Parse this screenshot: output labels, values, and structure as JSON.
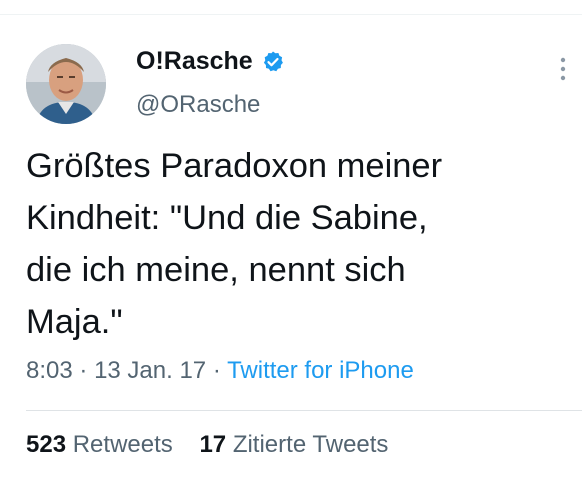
{
  "user": {
    "display_name": "O!Rasche",
    "handle": "@ORasche",
    "verified_icon": "verified-badge-icon",
    "verified_color": "#1d9bf0"
  },
  "tweet": {
    "text": "Größtes Paradoxon meiner\nKindheit: \"Und die Sabine,\ndie ich meine, nennt sich\nMaja.\"",
    "time": "8:03",
    "separator": "·",
    "date": "13 Jan. 17",
    "source": "Twitter for iPhone"
  },
  "stats": {
    "retweets_count": "523",
    "retweets_label": "Retweets",
    "quotes_count": "17",
    "quotes_label": "Zitierte Tweets"
  },
  "icons": {
    "more": "more-vertical-icon"
  },
  "colors": {
    "text": "#0f1419",
    "secondary": "#536471",
    "accent": "#1d9bf0"
  }
}
